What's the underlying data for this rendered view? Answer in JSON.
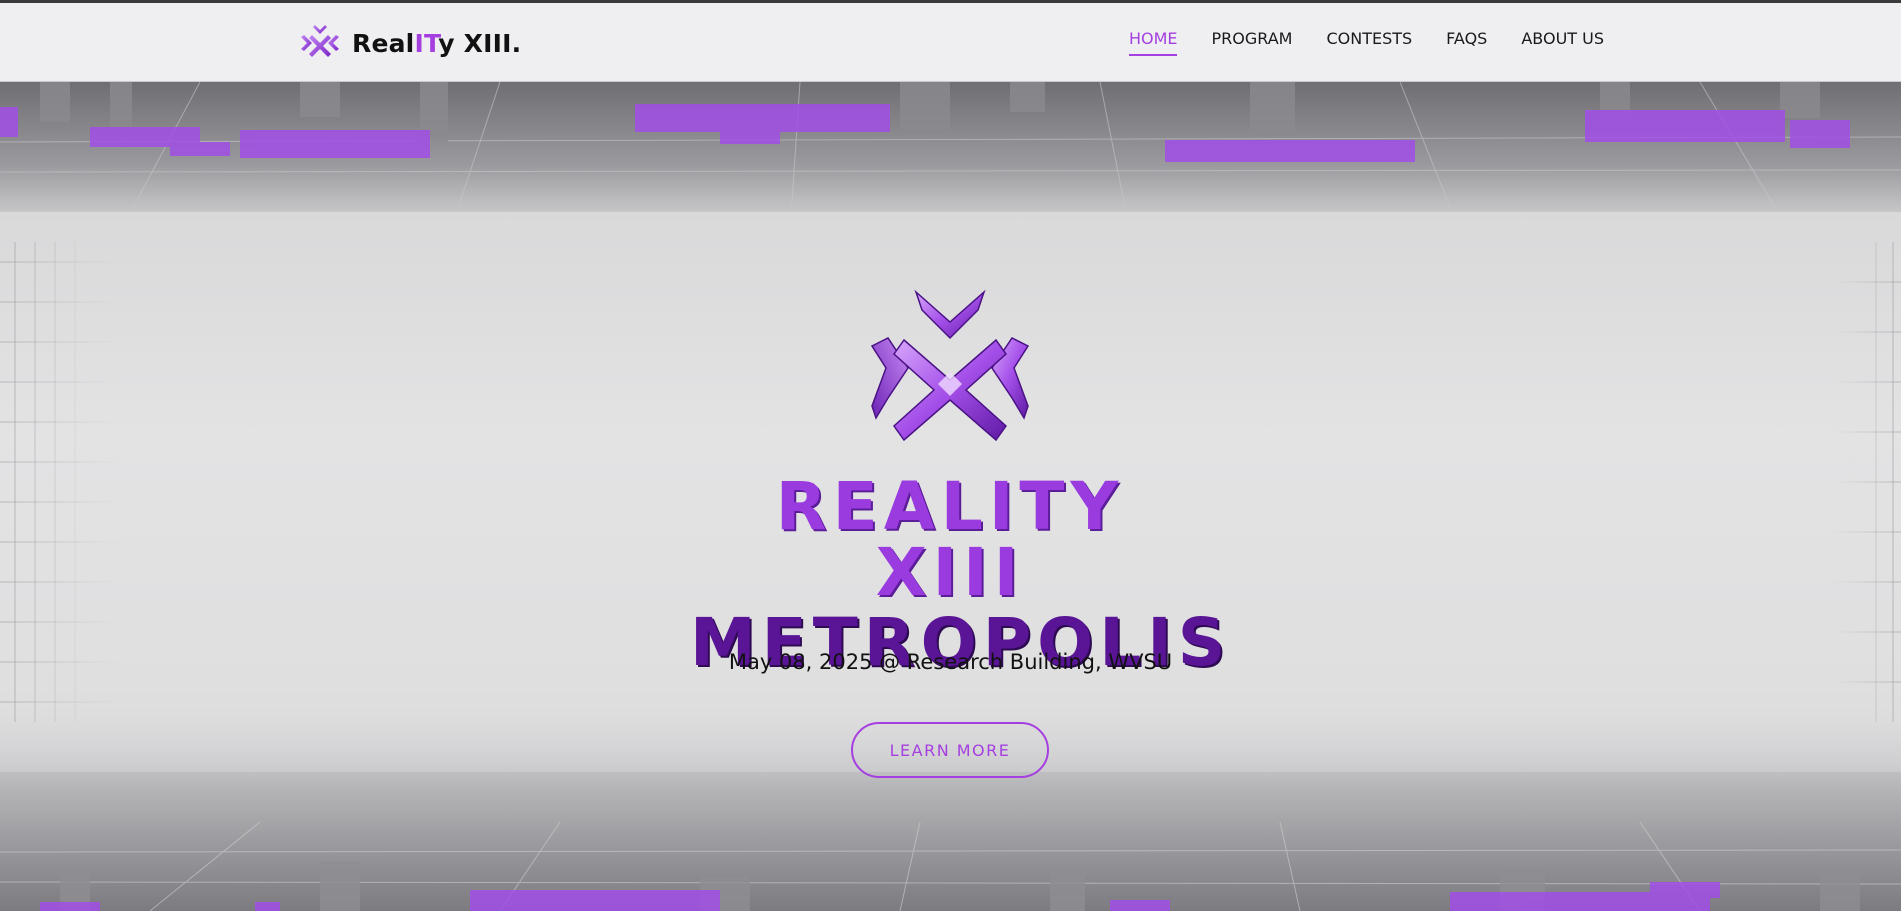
{
  "brand": {
    "prefix": "Real",
    "highlight": "IT",
    "suffix": "y XIII.",
    "logo_icon": "reality-x-logo-icon"
  },
  "nav": {
    "items": [
      {
        "label": "HOME",
        "active": true
      },
      {
        "label": "PROGRAM",
        "active": false
      },
      {
        "label": "CONTESTS",
        "active": false
      },
      {
        "label": "FAQS",
        "active": false
      },
      {
        "label": "ABOUT US",
        "active": false
      }
    ]
  },
  "hero": {
    "title_line1": "REALITY XIII",
    "title_line2": "METROPOLIS",
    "subtitle": "May 08, 2025 @ Research Building, WVSU",
    "cta_label": "LEARN MORE",
    "emblem_icon": "reality-x-emblem-icon"
  },
  "colors": {
    "accent": "#a53fe0",
    "deep_purple": "#5a1596",
    "nav_bg": "#efeff2",
    "hero_bg": "#e2e2e3"
  }
}
